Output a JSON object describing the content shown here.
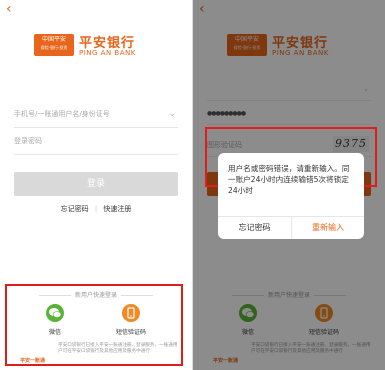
{
  "left": {
    "back_glyph": "‹",
    "brand": {
      "cn_small": "中国平安",
      "cn_small_sub": "保险·银行·投资",
      "name": "平安银行",
      "en": "PING AN BANK"
    },
    "fields": {
      "account_placeholder": "手机号/一账通用户名/身份证号",
      "password_placeholder": "登录密码"
    },
    "login_label": "登录",
    "links": {
      "forgot": "忘记密码",
      "quick_register": "快速注册"
    },
    "quick_login": {
      "title": "新用户快速登录",
      "wechat_label": "微信",
      "sms_label": "短信验证码",
      "footer_logo": "平安一账通",
      "footer_text": "平安口袋银行已接入平安一账通注册、登录服务，一账通用户可在平安口袋银行及其他应用及服务中通行"
    }
  },
  "right": {
    "back_glyph": "‹",
    "brand": {
      "cn_small": "中国平安",
      "cn_small_sub": "保险·银行·投资",
      "name": "平安银行",
      "en": "PING AN BANK"
    },
    "password_masked": "●●●●●●●●●",
    "captcha_placeholder": "图形验证码",
    "captcha_value": "9375",
    "dialog": {
      "message": "用户名或密码错误，请重新输入。同一账户24小时内连续输错5次将锁定24小时",
      "forgot": "忘记密码",
      "retry": "重新输入"
    },
    "quick_login": {
      "title": "新用户快速登录",
      "wechat_label": "微信",
      "sms_label": "短信验证码",
      "footer_logo": "平安一账通",
      "footer_text": "平安口袋银行已接入平安一账通注册、登录服务，一账通用户可在平安口袋银行及其他应用及服务中通行"
    }
  },
  "colors": {
    "accent": "#e8651b",
    "highlight": "#e21b1b",
    "wechat": "#59b436",
    "sms": "#f08a24"
  }
}
